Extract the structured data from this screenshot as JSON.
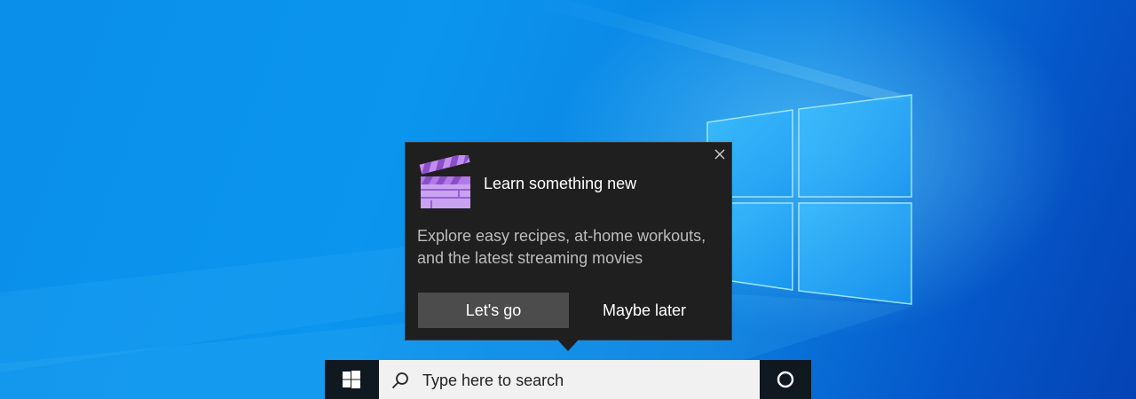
{
  "popup": {
    "title": "Learn something new",
    "body_line1": "Explore easy recipes, at-home workouts,",
    "body_line2": "and the latest streaming movies",
    "primary_label": "Let's go",
    "secondary_label": "Maybe later",
    "icon": "clapperboard-icon",
    "close_icon": "close-icon"
  },
  "taskbar": {
    "start_icon": "windows-logo-icon",
    "search_icon": "search-icon",
    "search_placeholder": "Type here to search",
    "cortana_icon": "cortana-circle-icon"
  },
  "colors": {
    "popup_bg": "#1f1f1f",
    "primary_button_bg": "#4c4c4c",
    "taskbar_bg": "#101820",
    "search_bg": "#f1f1f1",
    "accent_purple": "#b06ee0"
  }
}
